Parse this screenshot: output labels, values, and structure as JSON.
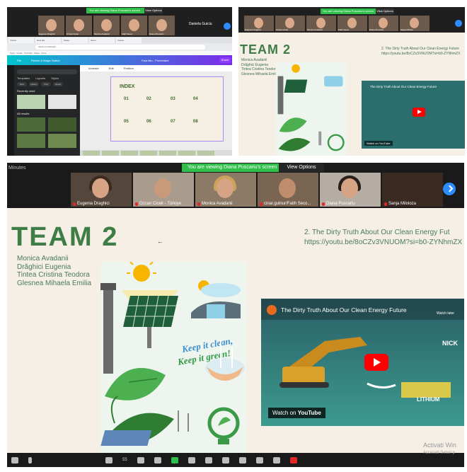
{
  "top_left": {
    "banner_text": "You are viewing Diana Puscariu's screen",
    "view_options": "View Options",
    "participants": [
      "Eugenia Draghici",
      "Ozcan Cicek",
      "Monica Avadanii",
      "Fatih Secer",
      "Diana Puscariu"
    ],
    "host_name": "Daniela Guiciu",
    "tabs": [
      "Canva",
      "New tab",
      "Slides",
      "Zoom",
      "Canva"
    ],
    "url": "canva.com/design/...",
    "bookmarks": "Apps · Gmail · YouTube · Maps · Drive",
    "canva_items": [
      "File",
      "Resize & Magic Switch",
      "Fara titlu - Prezentare"
    ],
    "share_label": "Share",
    "panel_tabs": [
      "Templates",
      "Layouts",
      "Styles"
    ],
    "panel_pills": [
      "Brat",
      "History",
      "Pink",
      "Green"
    ],
    "recently_used": "Recently used",
    "all_results": "All results",
    "toolbar": [
      "Animate",
      "Edit",
      "Position"
    ],
    "slide": {
      "title": "INDEX",
      "numbers": [
        "01",
        "02",
        "03",
        "04",
        "05",
        "06",
        "07",
        "08"
      ]
    }
  },
  "top_right": {
    "banner_text": "You are viewing Diana Puscariu's screen",
    "view_options": "View Options",
    "participants": [
      "Eugenia Draghici",
      "Ozcan Cicek",
      "Monica Avadanii",
      "Fatih Secer",
      "Diana Puscariu",
      "Sanja Milolos"
    ],
    "team_title": "TEAM 2",
    "members": [
      "Monica Avadanii",
      "Drăghici Eugenia",
      "Tintea Cristina Teodora",
      "Glesnea Mihaela Emilia"
    ],
    "link_title": "2. The Dirty Truth About Our Clean Energy Future",
    "link_url": "https://youtu.be/8oCZv3VNUOM?si=b0-ZYNhmZX",
    "video_title": "The Dirty Truth About Our Clean Energy Future",
    "watch_on": "Watch on YouTube"
  },
  "main": {
    "minutes_label": "Minutes",
    "banner_text": "You are viewing Diana Puscariu's screen",
    "view_options": "View Options",
    "participants": [
      {
        "name": "Eugenia Draghici"
      },
      {
        "name": "Ozcan Cicek - Türkiye"
      },
      {
        "name": "Monica Avadanii"
      },
      {
        "name": "cinar.gulnur/Fatih Seco..."
      },
      {
        "name": "Diana Puscariu"
      },
      {
        "name": "Sanja Miloloza"
      }
    ],
    "slide": {
      "team_title": "TEAM 2",
      "members": [
        "Monica Avadanii",
        "Drăghici Eugenia",
        "Tintea Cristina Teodora",
        "Glesnea Mihaela Emilia"
      ],
      "link_title": "2. The Dirty Truth About Our Clean Energy Fut",
      "link_url": "https://youtu.be/8oCZv3VNUOM?si=b0-ZYNhmZX",
      "art_slogan_1": "Keep it clean,",
      "art_slogan_2": "Keep it green!",
      "video": {
        "title": "The Dirty Truth About Our Clean Energy Future",
        "badge_text": "Watch later",
        "watch_prefix": "Watch on",
        "watch_brand": "YouTube",
        "text_nick": "NICK",
        "text_lithium": "LITHIUM"
      }
    },
    "participant_count": "55",
    "activate_line1": "Activati Win",
    "activate_line2": "Accesati Setari p"
  },
  "colors": {
    "team_green": "#3f7d46",
    "zoom_green": "#2fbf4a",
    "zoom_blue": "#2d8cff",
    "youtube_red": "#ff0000",
    "slide_bg": "#f5efe6"
  }
}
